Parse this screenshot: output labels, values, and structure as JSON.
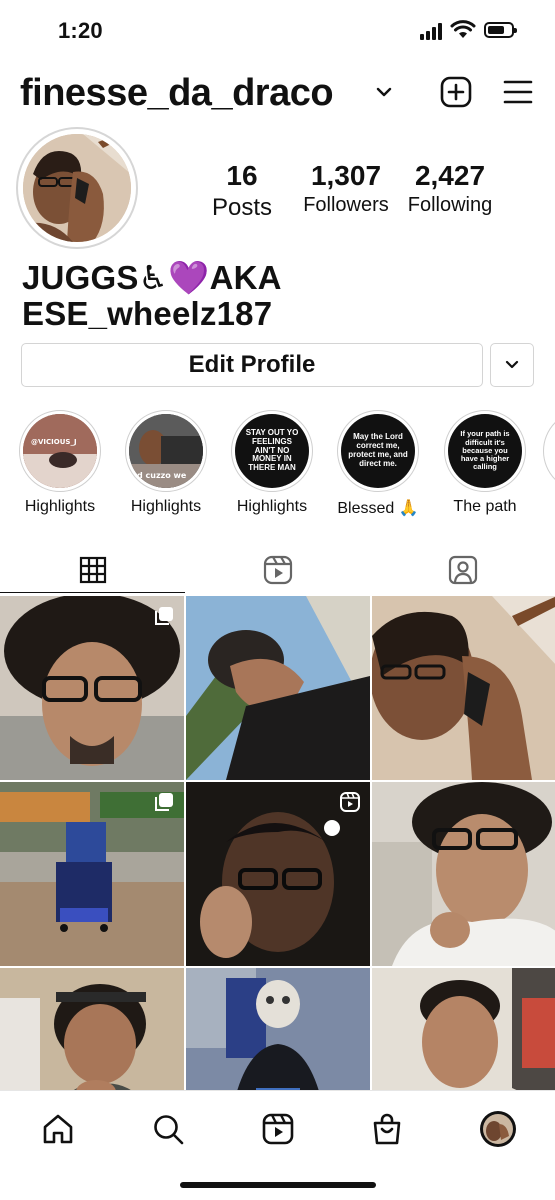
{
  "status_bar": {
    "time": "1:20"
  },
  "header": {
    "username": "finesse_da_draco"
  },
  "profile": {
    "stats": [
      {
        "value": "16",
        "label": "Posts"
      },
      {
        "value": "1,307",
        "label": "Followers"
      },
      {
        "value": "2,427",
        "label": "Following"
      }
    ],
    "bio_line1": "JUGGS♿💜AKA",
    "bio_line2": "ESE_wheelz187",
    "edit_button": "Edit Profile"
  },
  "highlights": [
    {
      "label": "Highlights",
      "cover_text": "@VICIOUS_J"
    },
    {
      "label": "Highlights",
      "cover_text": "d cuzzo we"
    },
    {
      "label": "Highlights",
      "cover_text": "STAY OUT YO FEELINGS AIN'T NO MONEY IN THERE MAN"
    },
    {
      "label": "Blessed 🙏",
      "cover_text": "May the Lord correct me, protect me, and direct me."
    },
    {
      "label": "The path",
      "cover_text": "If your path is difficult it's because you have a higher calling"
    }
  ],
  "tabs": [
    "grid-icon",
    "reels-icon",
    "tagged-icon"
  ],
  "posts": [
    {
      "type": "carousel"
    },
    {
      "type": "photo"
    },
    {
      "type": "photo"
    },
    {
      "type": "carousel"
    },
    {
      "type": "reel"
    },
    {
      "type": "photo"
    },
    {
      "type": "photo"
    },
    {
      "type": "photo"
    },
    {
      "type": "photo"
    }
  ],
  "bottom_nav": [
    "home-icon",
    "search-icon",
    "reels-icon",
    "shop-icon",
    "profile-avatar"
  ]
}
